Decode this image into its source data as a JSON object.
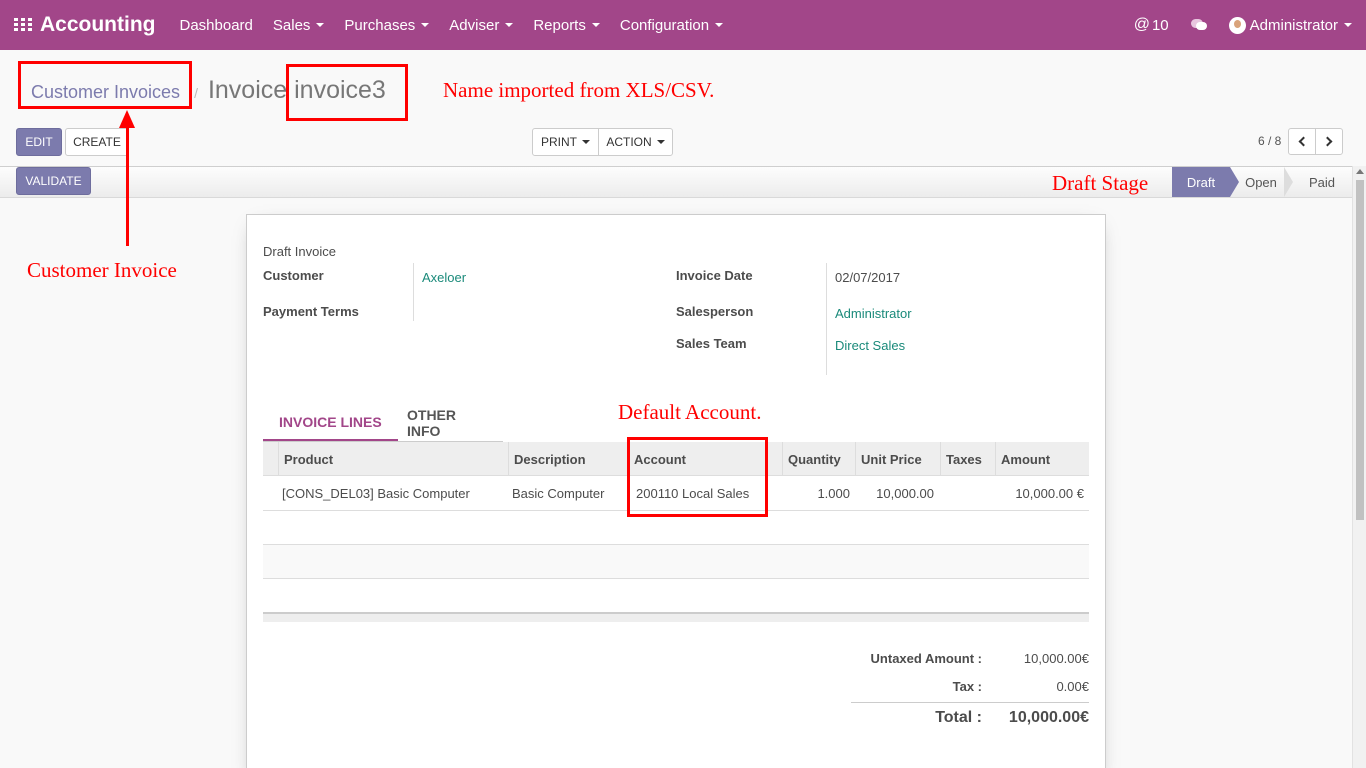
{
  "navbar": {
    "app_title": "Accounting",
    "menu": [
      "Dashboard",
      "Sales",
      "Purchases",
      "Adviser",
      "Reports",
      "Configuration"
    ],
    "mentions_count": "10",
    "user_name": "Administrator",
    "color": "#a24689"
  },
  "breadcrumb": {
    "parent": "Customer Invoices",
    "current": "Invoice invoice3"
  },
  "buttons": {
    "edit": "EDIT",
    "create": "CREATE",
    "print": "PRINT",
    "action": "ACTION",
    "validate": "VALIDATE"
  },
  "pager": {
    "text": "6 / 8"
  },
  "status": {
    "stages": [
      "Draft",
      "Open",
      "Paid"
    ],
    "active": "Draft"
  },
  "form": {
    "title": "Draft Invoice",
    "customer_label": "Customer",
    "customer_value": "Axeloer",
    "payment_terms_label": "Payment Terms",
    "invoice_date_label": "Invoice Date",
    "invoice_date_value": "02/07/2017",
    "salesperson_label": "Salesperson",
    "salesperson_value": "Administrator",
    "sales_team_label": "Sales Team",
    "sales_team_value": "Direct Sales"
  },
  "tabs": [
    "INVOICE LINES",
    "OTHER INFO"
  ],
  "lines": {
    "columns": [
      "Product",
      "Description",
      "Account",
      "Quantity",
      "Unit Price",
      "Taxes",
      "Amount"
    ],
    "rows": [
      {
        "product": "[CONS_DEL03] Basic Computer",
        "description": "Basic Computer",
        "account": "200110 Local Sales",
        "quantity": "1.000",
        "unit_price": "10,000.00",
        "taxes": "",
        "amount": "10,000.00 €"
      }
    ]
  },
  "totals": {
    "untaxed_label": "Untaxed Amount :",
    "untaxed_value": "10,000.00€",
    "tax_label": "Tax :",
    "tax_value": "0.00€",
    "total_label": "Total :",
    "total_value": "10,000.00€"
  },
  "annotations": {
    "name_note": "Name imported from XLS/CSV.",
    "customer_invoice_note": "Customer Invoice",
    "draft_note": "Draft Stage",
    "account_note": "Default Account.",
    "color": "#ff0000"
  }
}
